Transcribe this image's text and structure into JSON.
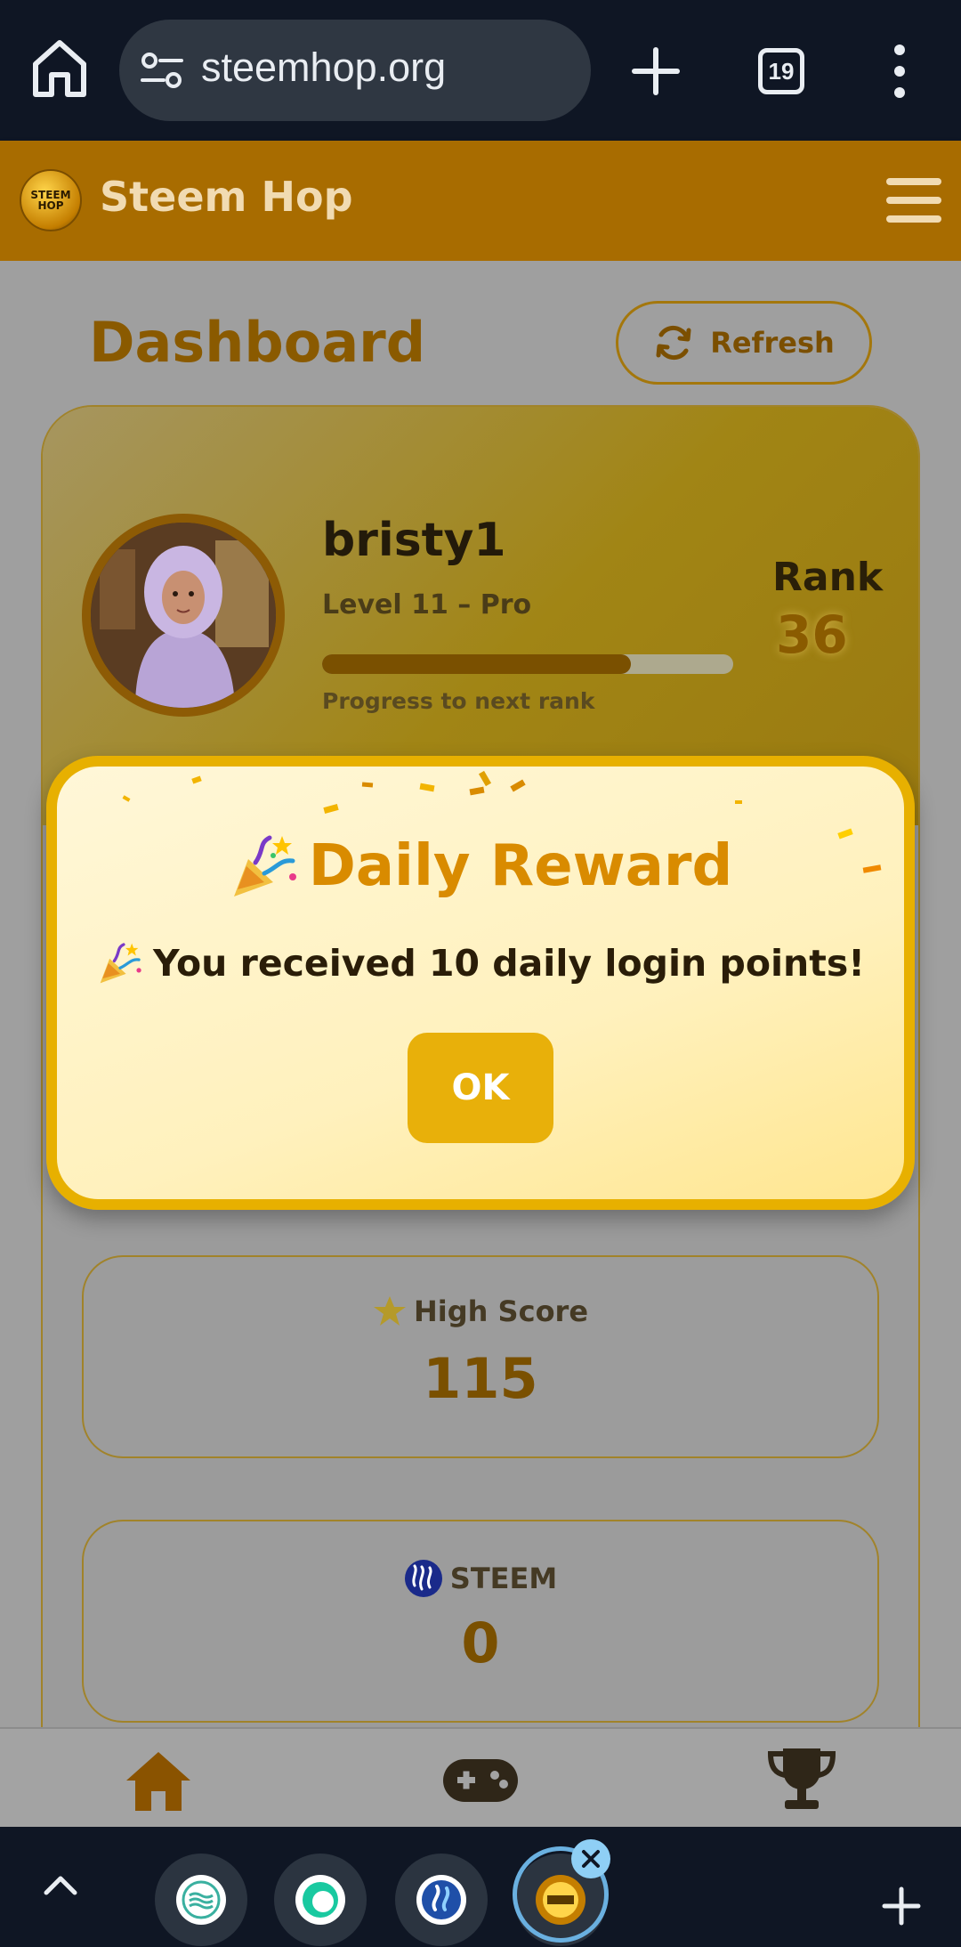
{
  "browser": {
    "url": "steemhop.org",
    "tab_count": "19"
  },
  "app": {
    "title": "Steem Hop",
    "logo_text": "STEEM HOP"
  },
  "dashboard": {
    "title": "Dashboard",
    "refresh_label": "Refresh",
    "profile": {
      "username": "bristy1",
      "level": "Level 11 – Pro",
      "progress_label": "Progress to next rank",
      "progress_fraction": 0.75,
      "rank_label": "Rank",
      "rank_value": "36"
    },
    "stats": [
      {
        "label": "High Score",
        "value": "115",
        "icon": "star-icon"
      },
      {
        "label": "STEEM",
        "value": "0",
        "icon": "steem-logo-icon"
      }
    ]
  },
  "modal": {
    "title": "Daily Reward",
    "message": "You received 10 daily login points!",
    "ok_label": "OK",
    "icon": "party-popper-icon"
  },
  "bottom_nav": {
    "items": [
      {
        "name": "home",
        "icon": "home-icon"
      },
      {
        "name": "games",
        "icon": "gamepad-icon"
      },
      {
        "name": "leaderboard",
        "icon": "trophy-icon"
      }
    ]
  },
  "colors": {
    "header": "#a86c00",
    "accent": "#e8b00a",
    "modal_border": "#e7b000",
    "modal_title": "#d98b00",
    "browser_bg": "#0f1624"
  }
}
